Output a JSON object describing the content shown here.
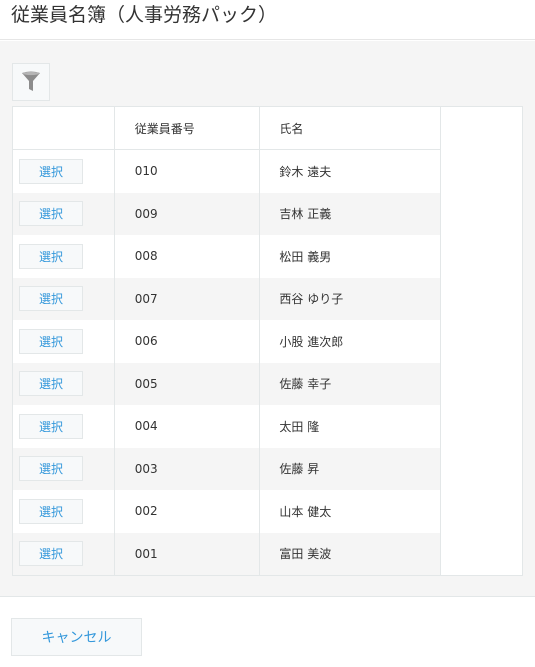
{
  "header": {
    "title": "従業員名簿（人事労務パック）"
  },
  "toolbar": {
    "filter_icon": "filter-icon"
  },
  "table": {
    "columns": [
      "",
      "従業員番号",
      "氏名"
    ],
    "select_label": "選択",
    "rows": [
      {
        "number": "010",
        "name": "鈴木 遠夫"
      },
      {
        "number": "009",
        "name": "吉林 正義"
      },
      {
        "number": "008",
        "name": "松田 義男"
      },
      {
        "number": "007",
        "name": "西谷 ゆり子"
      },
      {
        "number": "006",
        "name": "小股 進次郎"
      },
      {
        "number": "005",
        "name": "佐藤 幸子"
      },
      {
        "number": "004",
        "name": "太田 隆"
      },
      {
        "number": "003",
        "name": "佐藤 昇"
      },
      {
        "number": "002",
        "name": "山本 健太"
      },
      {
        "number": "001",
        "name": "富田 美波"
      }
    ]
  },
  "footer": {
    "cancel_label": "キャンセル"
  },
  "colors": {
    "accent": "#3498db",
    "border": "#e3e7e8",
    "background": "#f5f5f5"
  }
}
